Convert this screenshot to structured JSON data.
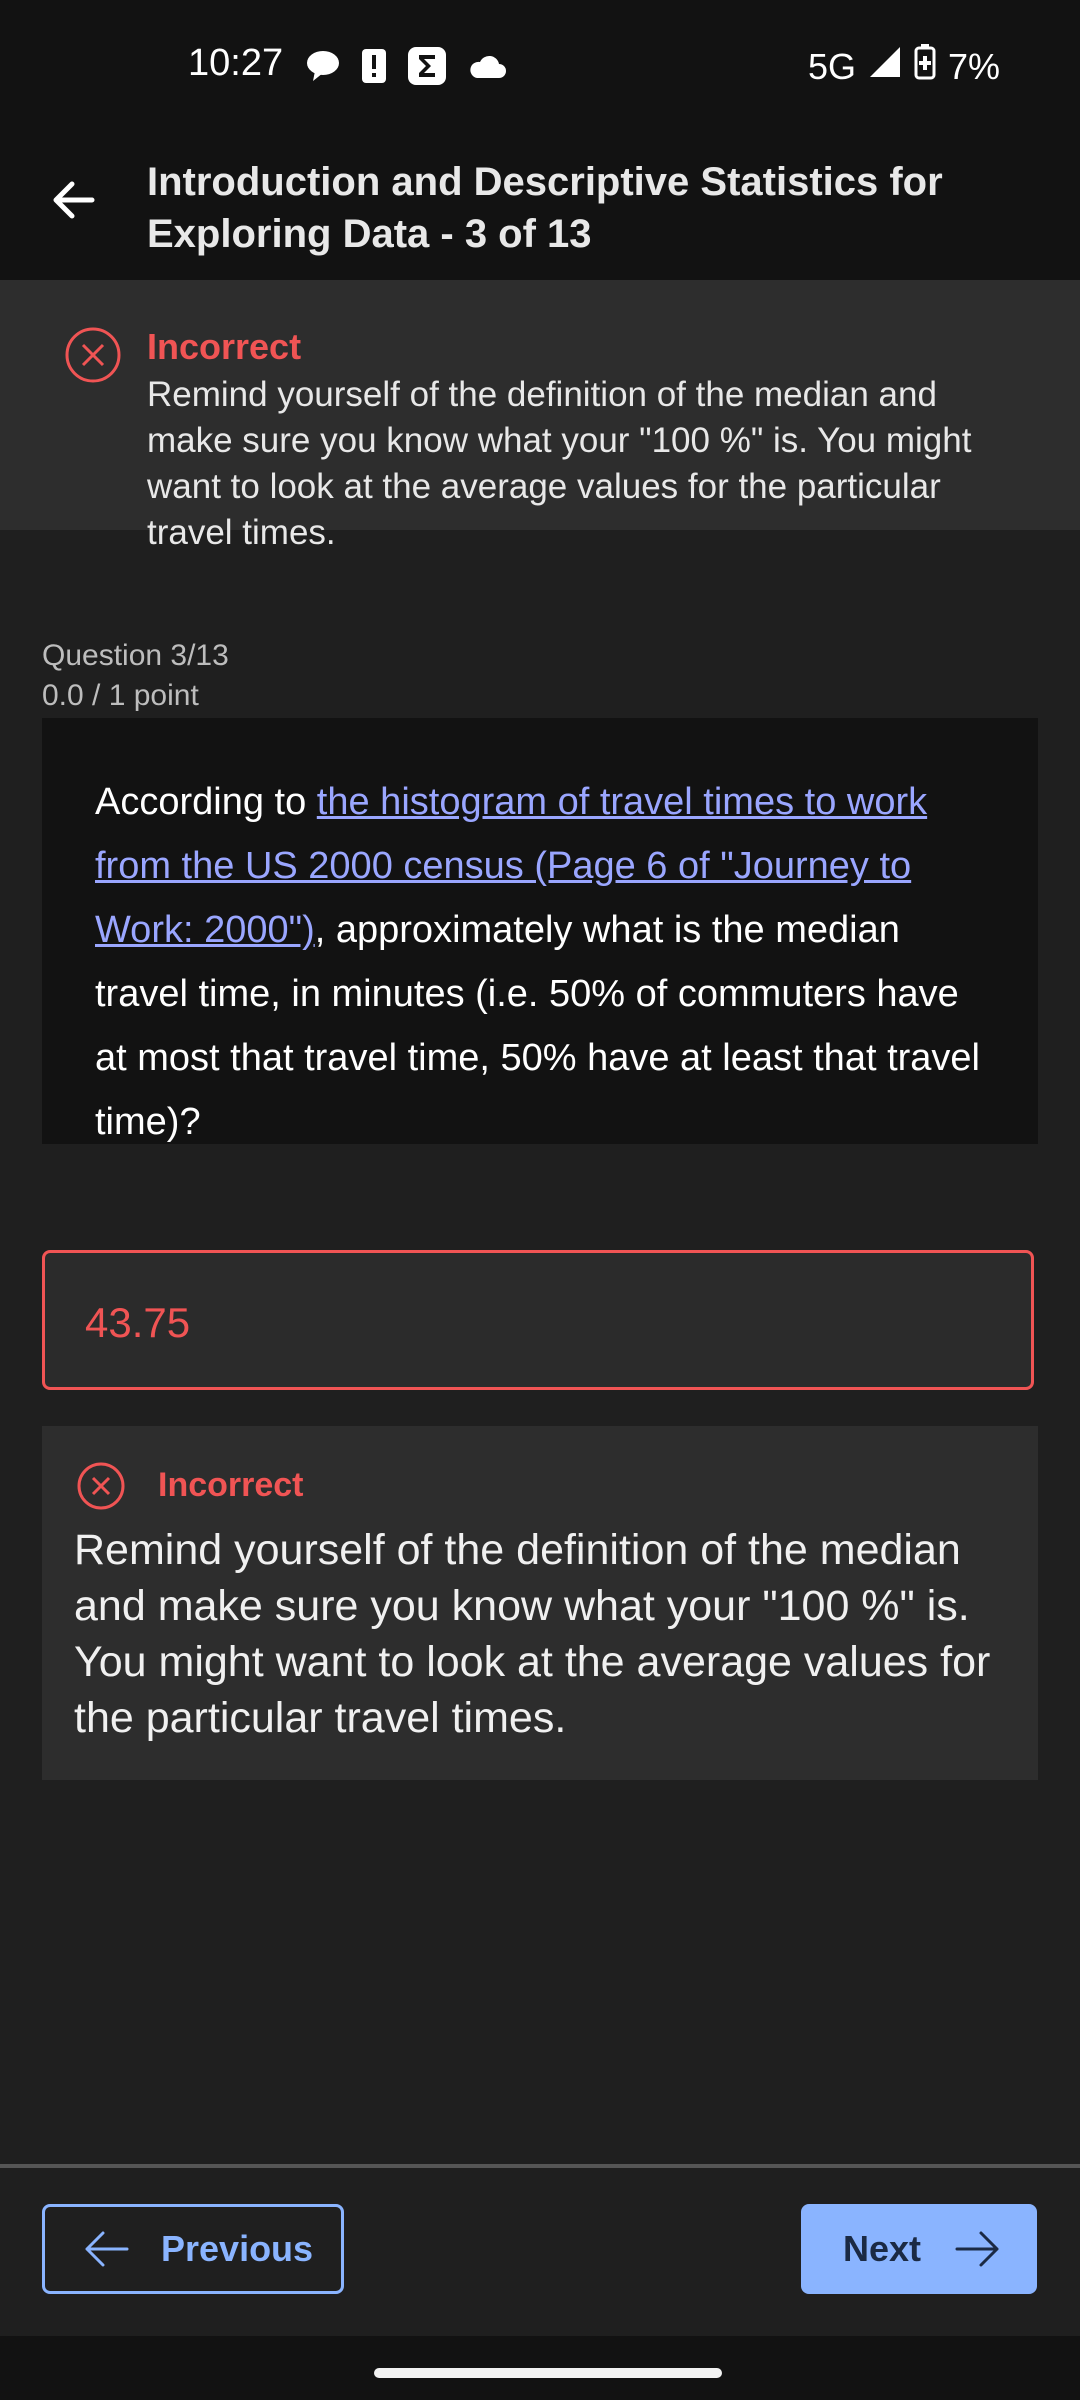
{
  "status_bar": {
    "time": "10:27",
    "network": "5G",
    "battery": "7%",
    "left_icons": [
      "chat-bubble-icon",
      "alert-icon",
      "sigma-app-icon",
      "cloud-icon"
    ],
    "right_icons": [
      "signal-icon",
      "battery-charging-icon"
    ]
  },
  "header": {
    "title": "Introduction and Descriptive Statistics for Exploring Data - 3 of 13"
  },
  "banner": {
    "status": "Incorrect",
    "message": "Remind yourself of the definition of the median and make sure you know what your \"100 %\" is. You might want to look at the average values for the particular travel times."
  },
  "question": {
    "number": "Question 3/13",
    "points": "0.0 / 1 point",
    "text_before": "According to ",
    "link_text": "the histogram of travel times to work from the US 2000 census (Page 6 of \"Journey to Work: 2000\")",
    "text_after": ", approximately what is the median travel time, in minutes (i.e. 50% of commuters have at most that travel time, 50% have at least that travel time)?"
  },
  "answer": {
    "value": "43.75"
  },
  "feedback": {
    "status": "Incorrect",
    "message": "Remind yourself of the definition of the median and make sure you know what your \"100 %\" is. You might want to look at the average values for the particular travel times."
  },
  "navigation": {
    "previous_label": "Previous",
    "next_label": "Next"
  },
  "colors": {
    "error": "#f05454",
    "accent": "#8ab4ff",
    "link": "#9aa6ff"
  }
}
